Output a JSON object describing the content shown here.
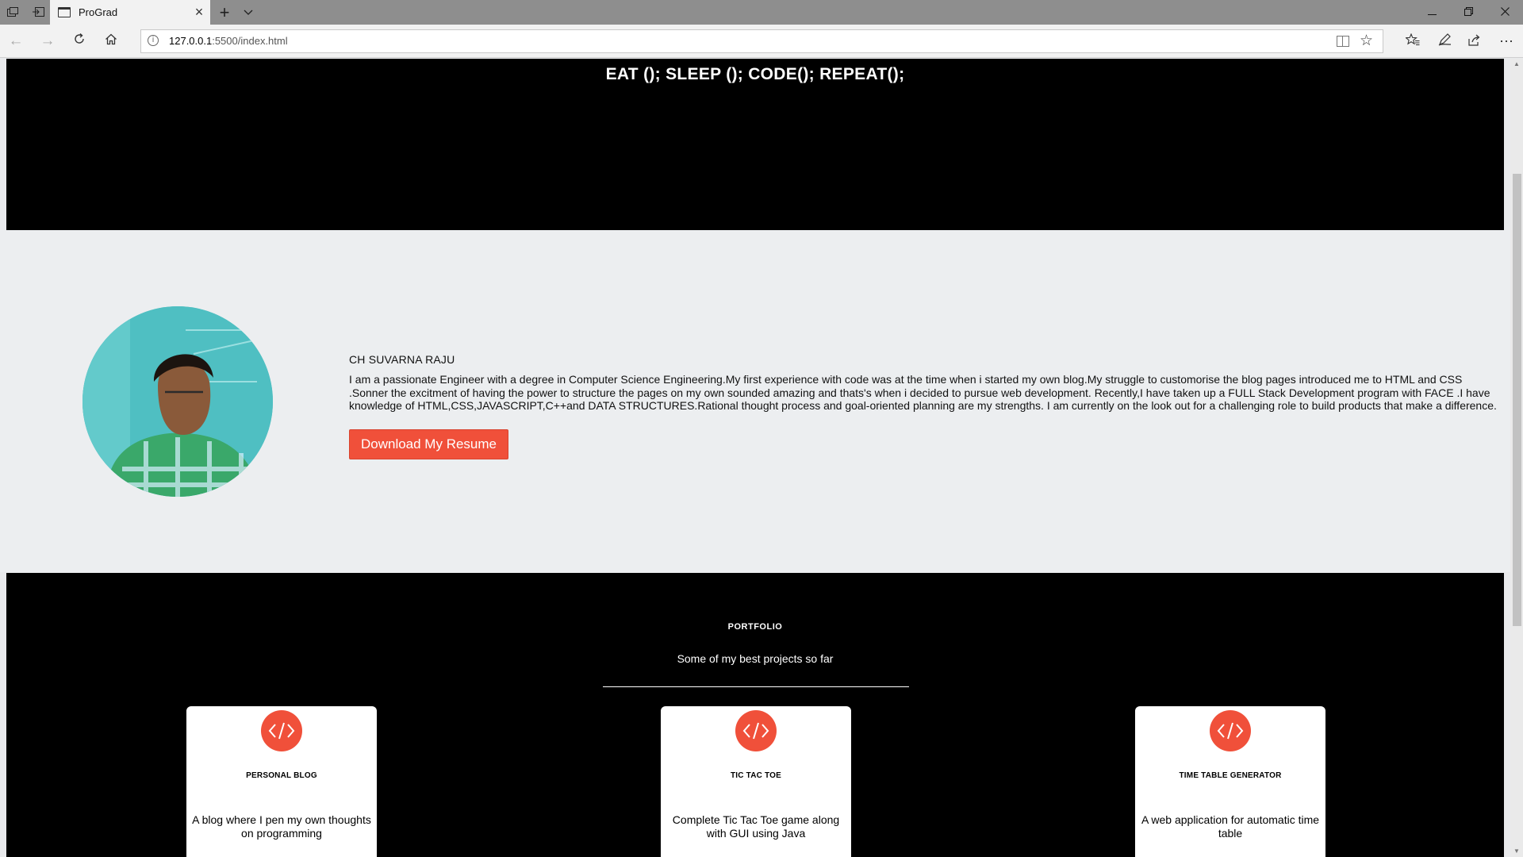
{
  "browser": {
    "tab_title": "ProGrad",
    "url_host": "127.0.0.1",
    "url_rest": ":5500/index.html"
  },
  "hero": {
    "title": "EAT (); SLEEP (); CODE(); REPEAT();"
  },
  "about": {
    "name": "CH SUVARNA RAJU",
    "bio": "I am a passionate Engineer with a degree in Computer Science Engineering.My first experience with code was at the time when i started my own blog.My struggle to customorise the blog pages introduced me to HTML and CSS .Sonner the excitment of having the power to structure the pages on my own sounded amazing and thats's when i decided to pursue web development. Recently,I have taken up a FULL Stack Development program with FACE .I have knowledge of HTML,CSS,JAVASCRIPT,C++and DATA STRUCTURES.Rational thought process and goal-oriented planning are my strengths. I am currently on the look out for a challenging role to build products that make a difference.",
    "resume_button": "Download My Resume"
  },
  "portfolio": {
    "title": "PORTFOLIO",
    "subtitle": "Some of my best projects so far",
    "projects": [
      {
        "title": "PERSONAL BLOG",
        "description": "A blog where I pen my own thoughts on programming"
      },
      {
        "title": "TIC TAC TOE",
        "description": "Complete Tic Tac Toe game along with GUI using Java"
      },
      {
        "title": "TIME TABLE GENERATOR",
        "description": "A web application for automatic time table"
      }
    ]
  },
  "colors": {
    "accent": "#f0503a",
    "hero_bg": "#000000",
    "about_bg": "#eceef0"
  },
  "icons": [
    "code-icon"
  ]
}
